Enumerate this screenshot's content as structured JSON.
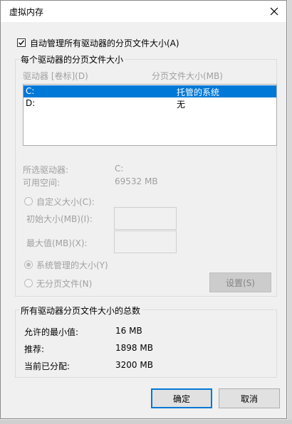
{
  "window": {
    "title": "虚拟内存"
  },
  "auto_manage": {
    "label": "自动管理所有驱动器的分页文件大小(A)",
    "checked": true
  },
  "drives_group": {
    "title": "每个驱动器的分页文件大小",
    "col_drive": "驱动器 [卷标](D)",
    "col_size": "分页文件大小(MB)",
    "rows": [
      {
        "drive": "C:",
        "size": "托管的系统",
        "selected": true
      },
      {
        "drive": "D:",
        "size": "无",
        "selected": false
      }
    ],
    "selected_drive_label": "所选驱动器:",
    "selected_drive_value": "C:",
    "free_space_label": "可用空间:",
    "free_space_value": "69532 MB",
    "custom_size_label": "自定义大小(C):",
    "initial_size_label": "初始大小(MB)(I):",
    "max_size_label": "最大值(MB)(X):",
    "system_managed_label": "系统管理的大小(Y)",
    "no_paging_label": "无分页文件(N)",
    "set_button": "设置(S)"
  },
  "totals_group": {
    "title": "所有驱动器分页文件大小的总数",
    "min_allowed_label": "允许的最小值:",
    "min_allowed_value": "16 MB",
    "recommended_label": "推荐:",
    "recommended_value": "1898 MB",
    "allocated_label": "当前已分配:",
    "allocated_value": "3200 MB"
  },
  "buttons": {
    "ok": "确定",
    "cancel": "取消"
  },
  "colors": {
    "selection": "#0078d7",
    "disabled_text": "#a0a0a0"
  },
  "icons": {
    "close": "close-icon",
    "check": "checkmark-icon"
  }
}
